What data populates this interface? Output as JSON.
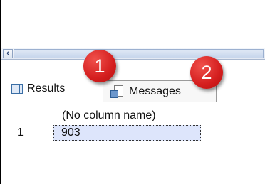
{
  "scrollbar": {
    "left_arrow_icon": "chevron-left-icon"
  },
  "tabs": {
    "results": {
      "label": "Results",
      "icon": "grid-icon"
    },
    "messages": {
      "label": "Messages",
      "icon": "messages-icon"
    }
  },
  "badges": [
    "1",
    "2"
  ],
  "grid": {
    "columns": [
      "(No column name)"
    ],
    "rows": [
      {
        "row_number": "1",
        "values": [
          "903"
        ]
      }
    ]
  },
  "colors": {
    "badge": "#d41e1e",
    "selected_cell": "#dde5fb"
  }
}
